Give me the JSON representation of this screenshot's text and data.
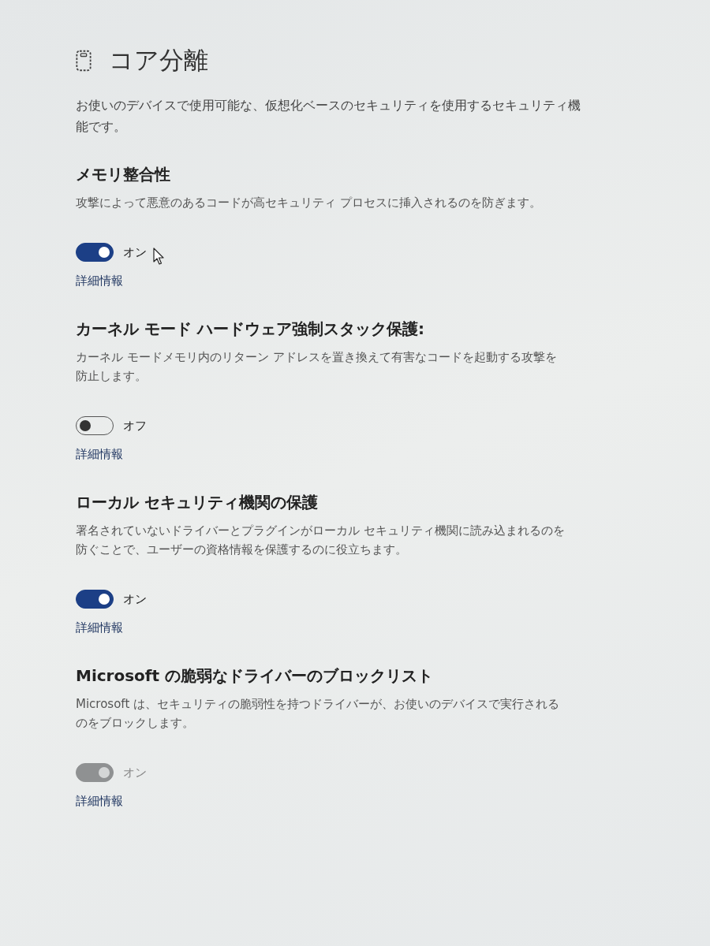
{
  "page": {
    "title": "コア分離",
    "description": "お使いのデバイスで使用可能な、仮想化ベースのセキュリティを使用するセキュリティ機能です。"
  },
  "sections": [
    {
      "title": "メモリ整合性",
      "description": "攻撃によって悪意のあるコードが高セキュリティ プロセスに挿入されるのを防ぎます。",
      "toggle": {
        "on": true,
        "disabled": false,
        "hovered": true,
        "label": "オン"
      },
      "link": "詳細情報"
    },
    {
      "title": "カーネル モード ハードウェア強制スタック保護:",
      "description": "カーネル モードメモリ内のリターン アドレスを置き換えて有害なコードを起動する攻撃を防止します。",
      "toggle": {
        "on": false,
        "disabled": false,
        "hovered": false,
        "label": "オフ"
      },
      "link": "詳細情報"
    },
    {
      "title": "ローカル セキュリティ機関の保護",
      "description": "署名されていないドライバーとプラグインがローカル セキュリティ機関に読み込まれるのを防ぐことで、ユーザーの資格情報を保護するのに役立ちます。",
      "toggle": {
        "on": true,
        "disabled": false,
        "hovered": false,
        "label": "オン"
      },
      "link": "詳細情報"
    },
    {
      "title": "Microsoft の脆弱なドライバーのブロックリスト",
      "description": "Microsoft は、セキュリティの脆弱性を持つドライバーが、お使いのデバイスで実行されるのをブロックします。",
      "toggle": {
        "on": true,
        "disabled": true,
        "hovered": false,
        "label": "オン"
      },
      "link": "詳細情報"
    }
  ]
}
